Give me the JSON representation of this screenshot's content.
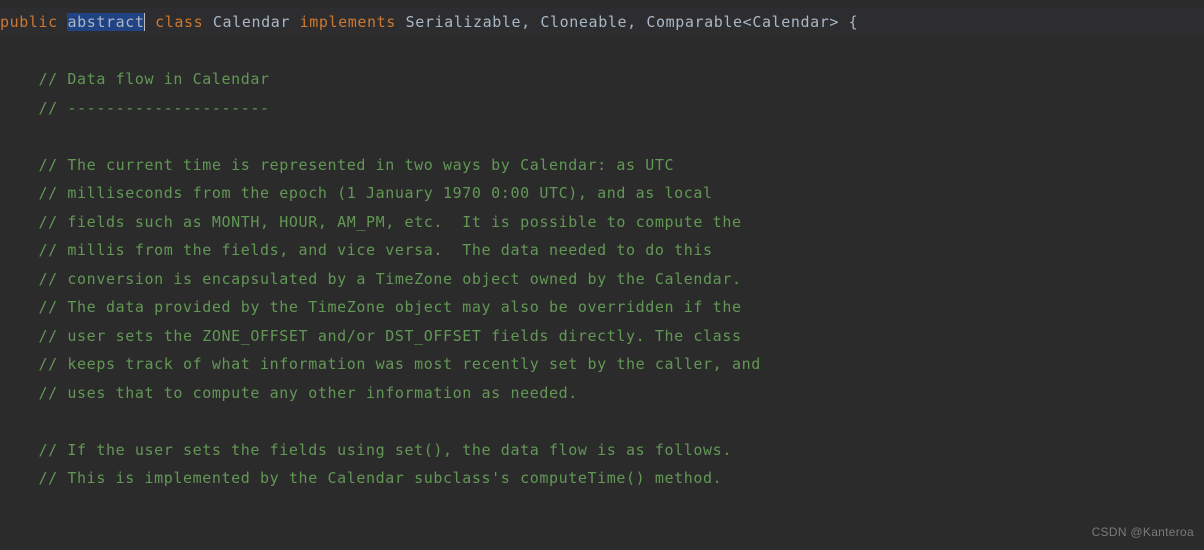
{
  "declaration": {
    "modifier_public": "public",
    "modifier_abstract": "abstract",
    "keyword_class": "class",
    "classname": "Calendar",
    "keyword_implements": "implements",
    "interface1": "Serializable",
    "interface2": "Cloneable",
    "interface3": "Comparable",
    "typeparam": "Calendar",
    "brace_open": "{"
  },
  "comments": {
    "c1": "// Data flow in Calendar",
    "c2": "// ---------------------",
    "c3": "// The current time is represented in two ways by Calendar: as UTC",
    "c4": "// milliseconds from the epoch (1 January 1970 0:00 UTC), and as local",
    "c5": "// fields such as MONTH, HOUR, AM_PM, etc.  It is possible to compute the",
    "c6": "// millis from the fields, and vice versa.  The data needed to do this",
    "c7": "// conversion is encapsulated by a TimeZone object owned by the Calendar.",
    "c8": "// The data provided by the TimeZone object may also be overridden if the",
    "c9": "// user sets the ZONE_OFFSET and/or DST_OFFSET fields directly. The class",
    "c10": "// keeps track of what information was most recently set by the caller, and",
    "c11": "// uses that to compute any other information as needed.",
    "c12": "// If the user sets the fields using set(), the data flow is as follows.",
    "c13": "// This is implemented by the Calendar subclass's computeTime() method."
  },
  "watermark": "CSDN @Kanteroa"
}
